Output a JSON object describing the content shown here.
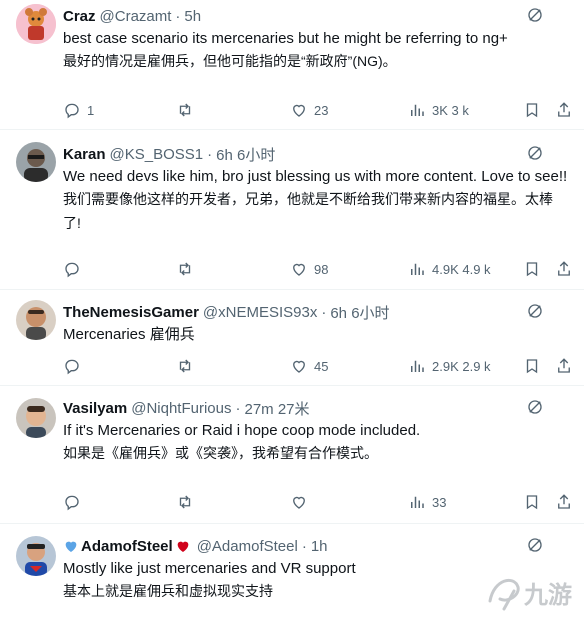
{
  "tweets": [
    {
      "name": "Craz",
      "handle": "@Crazamt",
      "time": "5h",
      "text_en": "best case scenario its mercenaries but he might be referring to ng+",
      "text_zh": "最好的情况是雇佣兵，但他可能指的是“新政府”(NG)。",
      "replies": "1",
      "retweets": "",
      "likes": "23",
      "views": "3K 3 k"
    },
    {
      "name": "Karan",
      "handle": "@KS_BOSS1",
      "time": "6h 6小时",
      "text_en": "We need devs like him, bro just blessing us with more content. Love to see!!",
      "text_zh": "我们需要像他这样的开发者，兄弟，他就是不断给我们带来新内容的福星。太棒了!",
      "replies": "",
      "retweets": "",
      "likes": "98",
      "views": "4.9K 4.9 k"
    },
    {
      "name": "TheNemesisGamer",
      "handle": "@xNEMESIS93x",
      "time": "6h 6小时",
      "text_en": "Mercenaries   雇佣兵",
      "text_zh": "",
      "replies": "",
      "retweets": "",
      "likes": "45",
      "views": "2.9K 2.9 k"
    },
    {
      "name": "Vasilyam",
      "handle": "@NiqhtFurious",
      "time": "27m 27米",
      "text_en": "If it's Mercenaries or Raid i hope coop mode included.",
      "text_zh": "如果是《雇佣兵》或《突袭》，我希望有合作模式。",
      "replies": "",
      "retweets": "",
      "likes": "",
      "views": "33"
    },
    {
      "name": "AdamofSteel",
      "handle": "@AdamofSteel",
      "time": "1h",
      "text_en": "Mostly like just mercenaries and VR support",
      "text_zh": "基本上就是雇佣兵和虚拟现实支持",
      "replies": "",
      "retweets": "",
      "likes": "",
      "views": ""
    }
  ],
  "watermark": "九游",
  "colors": {
    "text": "#0f1419",
    "muted": "#536471",
    "divider": "#eff3f4",
    "heart_blue": "#5ba4e6",
    "heart_red": "#d0021b"
  },
  "icons": [
    "reply-icon",
    "retweet-icon",
    "like-icon",
    "views-icon",
    "bookmark-icon",
    "share-icon",
    "grok-icon"
  ]
}
